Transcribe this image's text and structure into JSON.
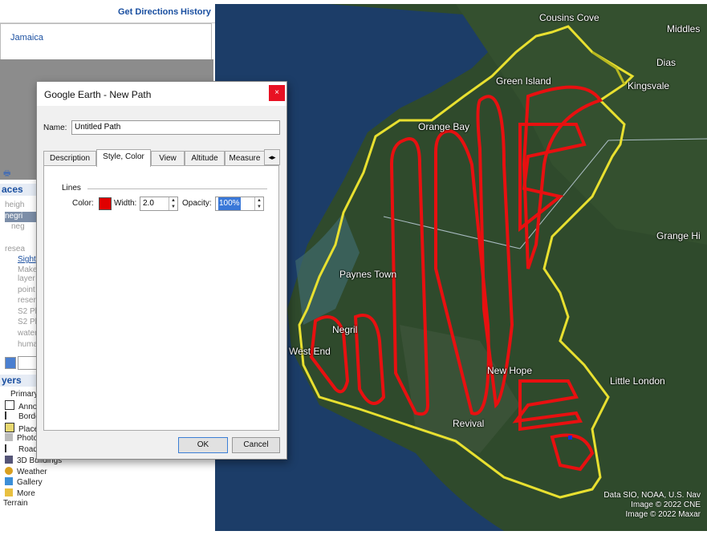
{
  "topbar": {
    "get_directions": "Get Directions",
    "history": "History"
  },
  "search": {
    "result": "Jamaica"
  },
  "places": {
    "header": "aces",
    "rows": [
      "heigh",
      "negri",
      "neg",
      "",
      "resea",
      "Sight",
      "Make",
      "layer",
      "point",
      "reser",
      "S2 Pl",
      "S2 Pl",
      "water",
      "huma"
    ]
  },
  "layers": {
    "header": "yers",
    "items": [
      "Primary",
      "Annot",
      "Borde",
      "Place",
      "Photo",
      "Roads",
      "3D Buildings",
      "Weather",
      "Gallery",
      "More",
      "Terrain"
    ]
  },
  "map": {
    "labels": [
      "Cousins Cove",
      "Middles",
      "Dias",
      "Green Island",
      "Kingsvale",
      "Orange Bay",
      "Grange Hi",
      "Paynes Town",
      "Negril",
      "West End",
      "New Hope",
      "Little London",
      "Revival"
    ],
    "attribution": [
      "Data SIO, NOAA, U.S. Nav",
      "Image © 2022 CNE",
      "Image © 2022 Maxar"
    ]
  },
  "dialog": {
    "title": "Google Earth - New Path",
    "close": "×",
    "name_label": "Name:",
    "name_value": "Untitled Path",
    "tabs": [
      "Description",
      "Style, Color",
      "View",
      "Altitude",
      "Measure"
    ],
    "tab_scroll": "◂▸",
    "group_label": "Lines",
    "color_label": "Color:",
    "color_value": "#e00000",
    "width_label": "Width:",
    "width_value": "2.0",
    "opacity_label": "Opacity:",
    "opacity_value": "100%",
    "ok": "OK",
    "cancel": "Cancel"
  }
}
